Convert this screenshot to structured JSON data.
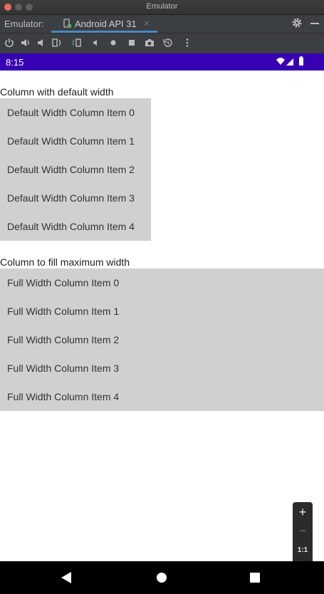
{
  "window": {
    "title": "Emulator"
  },
  "tabbar": {
    "label": "Emulator:",
    "tab": {
      "label": "Android API 31",
      "close": "×"
    }
  },
  "toolbar": {
    "tools": [
      "power-icon",
      "volume-up-icon",
      "volume-down-icon",
      "rotate-left-icon",
      "rotate-right-icon",
      "back-icon",
      "home-icon",
      "overview-icon",
      "camera-icon",
      "snapshot-icon",
      "more-icon"
    ]
  },
  "status": {
    "time": "8:15"
  },
  "content": {
    "default_title": "Column with default width",
    "default_items": [
      "Default Width Column Item 0",
      "Default Width Column Item 1",
      "Default Width Column Item 2",
      "Default Width Column Item 3",
      "Default Width Column Item 4"
    ],
    "full_title": "Column to fill maximum width",
    "full_items": [
      "Full Width Column Item 0",
      "Full Width Column Item 1",
      "Full Width Column Item 2",
      "Full Width Column Item 3",
      "Full Width Column Item 4"
    ]
  },
  "zoom": {
    "plus": "+",
    "minus": "−",
    "one_to_one": "1:1"
  },
  "colors": {
    "status_bar": "#3700b3",
    "column_bg": "#d0d0d0",
    "tab_accent": "#4a88c7"
  }
}
